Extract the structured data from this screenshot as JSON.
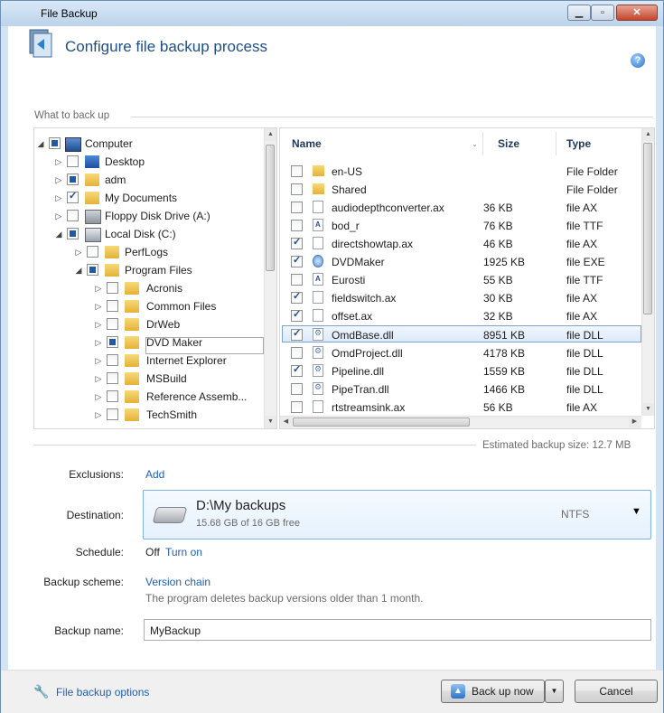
{
  "window": {
    "title": "File Backup"
  },
  "header": {
    "title": "Configure file backup process",
    "help": "?"
  },
  "what_to_backup": {
    "label": "What to back up"
  },
  "tree": {
    "items": [
      {
        "label": "Computer"
      },
      {
        "label": "Desktop"
      },
      {
        "label": "adm"
      },
      {
        "label": "My Documents"
      },
      {
        "label": "Floppy Disk Drive (A:)"
      },
      {
        "label": "Local Disk (C:)"
      },
      {
        "label": "PerfLogs"
      },
      {
        "label": "Program Files"
      },
      {
        "label": "Acronis"
      },
      {
        "label": "Common Files"
      },
      {
        "label": "DrWeb"
      },
      {
        "label": "DVD Maker"
      },
      {
        "label": "Internet Explorer"
      },
      {
        "label": "MSBuild"
      },
      {
        "label": "Reference Assemb..."
      },
      {
        "label": "TechSmith"
      }
    ]
  },
  "files": {
    "columns": {
      "name": "Name",
      "size": "Size",
      "type": "Type"
    },
    "rows": [
      {
        "name": "en-US",
        "size": "",
        "type": "File Folder"
      },
      {
        "name": "Shared",
        "size": "",
        "type": "File Folder"
      },
      {
        "name": "audiodepthconverter.ax",
        "size": "36 KB",
        "type": "file AX"
      },
      {
        "name": "bod_r",
        "size": "76 KB",
        "type": "file TTF"
      },
      {
        "name": "directshowtap.ax",
        "size": "46 KB",
        "type": "file AX"
      },
      {
        "name": "DVDMaker",
        "size": "1925 KB",
        "type": "file EXE"
      },
      {
        "name": "Eurosti",
        "size": "55 KB",
        "type": "file TTF"
      },
      {
        "name": "fieldswitch.ax",
        "size": "30 KB",
        "type": "file AX"
      },
      {
        "name": "offset.ax",
        "size": "32 KB",
        "type": "file AX"
      },
      {
        "name": "OmdBase.dll",
        "size": "8951 KB",
        "type": "file DLL"
      },
      {
        "name": "OmdProject.dll",
        "size": "4178 KB",
        "type": "file DLL"
      },
      {
        "name": "Pipeline.dll",
        "size": "1559 KB",
        "type": "file DLL"
      },
      {
        "name": "PipeTran.dll",
        "size": "1466 KB",
        "type": "file DLL"
      },
      {
        "name": "rtstreamsink.ax",
        "size": "56 KB",
        "type": "file AX"
      }
    ]
  },
  "estimate": {
    "text": "Estimated backup size: 12.7 MB"
  },
  "exclusions": {
    "label": "Exclusions:",
    "link": "Add"
  },
  "destination": {
    "label": "Destination:",
    "path": "D:\\My backups",
    "free": "15.68 GB of 16 GB free",
    "fs": "NTFS"
  },
  "schedule": {
    "label": "Schedule:",
    "value": "Off",
    "link": "Turn on"
  },
  "scheme": {
    "label": "Backup scheme:",
    "link": "Version chain",
    "note": "The program deletes backup versions older than 1 month."
  },
  "backup_name": {
    "label": "Backup name:",
    "value": "MyBackup"
  },
  "footer": {
    "options": "File backup options",
    "backup_now": "Back up now",
    "cancel": "Cancel"
  }
}
